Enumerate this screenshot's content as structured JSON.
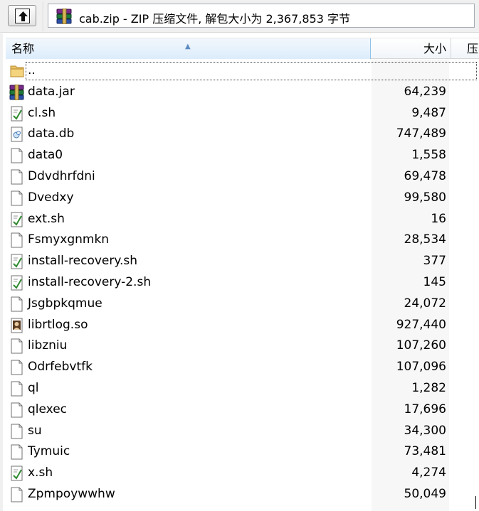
{
  "address": {
    "text": "cab.zip - ZIP 压缩文件, 解包大小为 2,367,853 字节"
  },
  "columns": {
    "name": "名称",
    "size": "大小",
    "packed": "压"
  },
  "parent": {
    "label": ".."
  },
  "files": [
    {
      "name": "data.jar",
      "size": "64,239",
      "icon": "archive-icon"
    },
    {
      "name": "cl.sh",
      "size": "9,487",
      "icon": "script-icon"
    },
    {
      "name": "data.db",
      "size": "747,489",
      "icon": "database-file-icon"
    },
    {
      "name": "data0",
      "size": "1,558",
      "icon": "file-icon"
    },
    {
      "name": "Ddvdhrfdni",
      "size": "69,478",
      "icon": "file-icon"
    },
    {
      "name": "Dvedxy",
      "size": "99,580",
      "icon": "file-icon"
    },
    {
      "name": "ext.sh",
      "size": "16",
      "icon": "script-icon"
    },
    {
      "name": "Fsmyxgnmkn",
      "size": "28,534",
      "icon": "file-icon"
    },
    {
      "name": "install-recovery.sh",
      "size": "377",
      "icon": "script-icon"
    },
    {
      "name": "install-recovery-2.sh",
      "size": "145",
      "icon": "script-icon"
    },
    {
      "name": "Jsgbpkqmue",
      "size": "24,072",
      "icon": "file-icon"
    },
    {
      "name": "librtlog.so",
      "size": "927,440",
      "icon": "library-icon"
    },
    {
      "name": "libzniu",
      "size": "107,260",
      "icon": "file-icon"
    },
    {
      "name": "Odrfebvtfk",
      "size": "107,096",
      "icon": "file-icon"
    },
    {
      "name": "ql",
      "size": "1,282",
      "icon": "file-icon"
    },
    {
      "name": "qlexec",
      "size": "17,696",
      "icon": "file-icon"
    },
    {
      "name": "su",
      "size": "34,300",
      "icon": "file-icon"
    },
    {
      "name": "Tymuic",
      "size": "73,481",
      "icon": "file-icon"
    },
    {
      "name": "x.sh",
      "size": "4,274",
      "icon": "script-icon"
    },
    {
      "name": "Zpmpoywwhw",
      "size": "50,049",
      "icon": "file-icon"
    }
  ]
}
